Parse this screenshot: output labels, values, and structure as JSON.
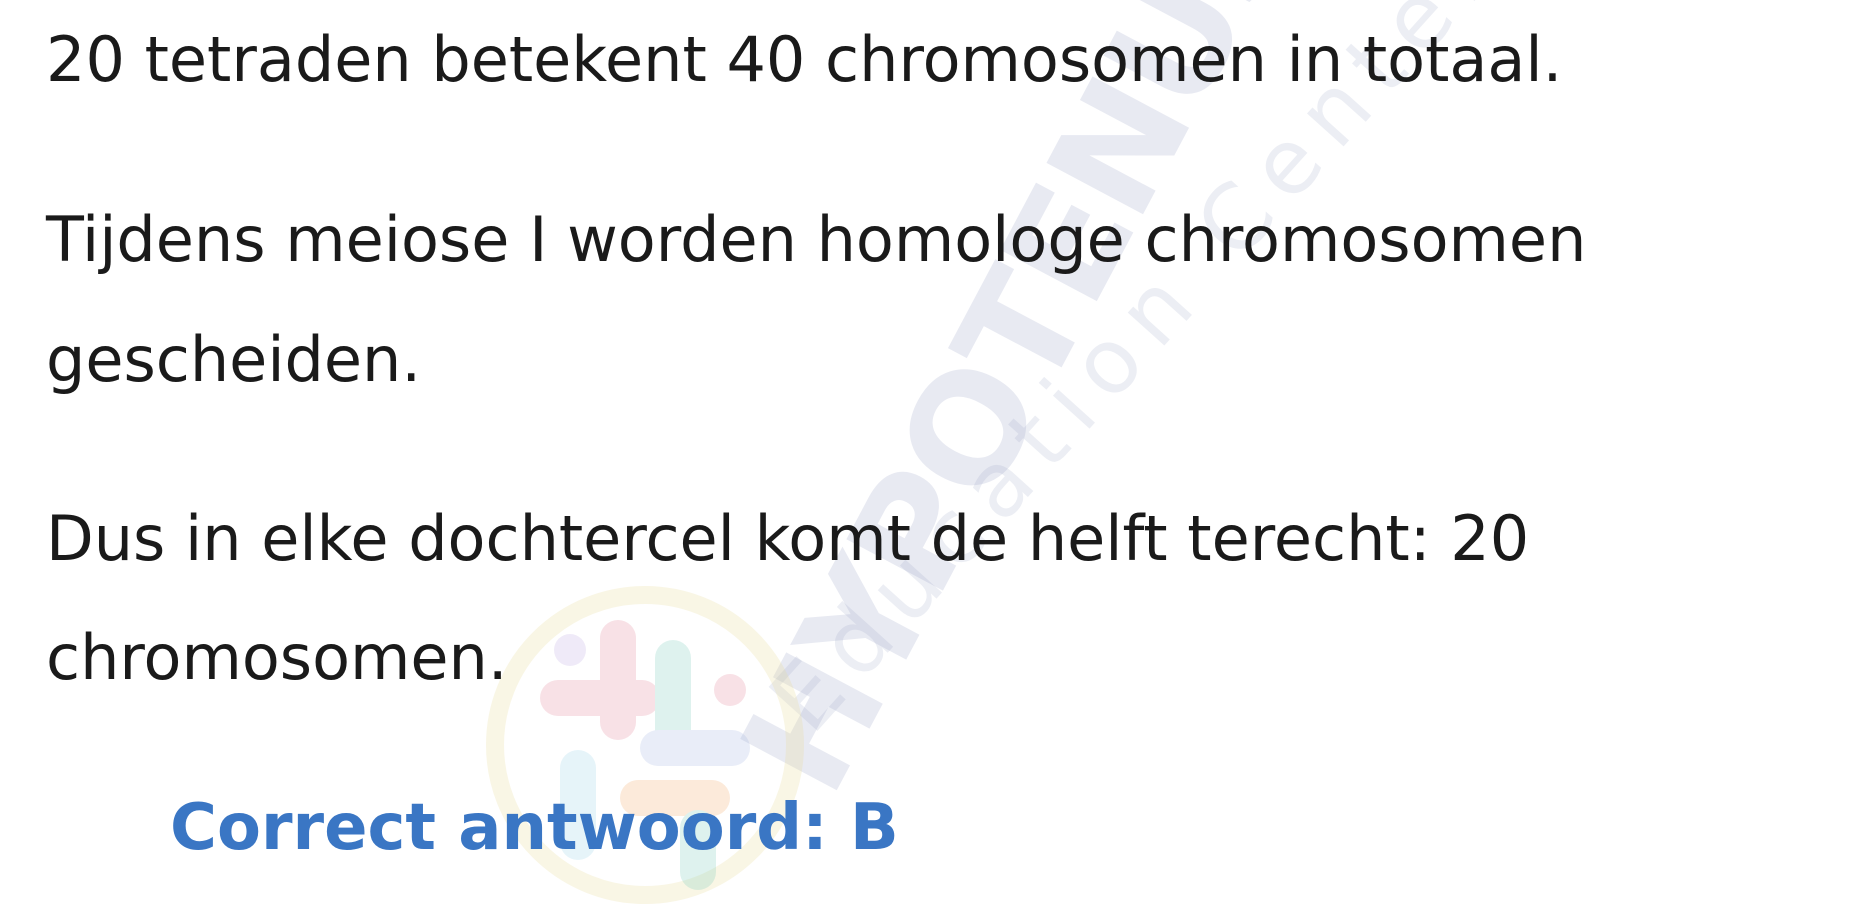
{
  "watermark": {
    "brand": "HYPOTENUSE",
    "tagline": "Education Center"
  },
  "content": {
    "paragraph_1": "20 tetraden betekent 40 chromosomen in totaal.",
    "paragraph_2_line_1": "Tijdens meiose I worden homologe chromosomen",
    "paragraph_2_line_2": "gescheiden.",
    "paragraph_3_line_1": "Dus in elke dochtercel komt de helft terecht: 20",
    "paragraph_3_line_2": "chromosomen."
  },
  "answer": {
    "text": "Correct antwoord: B",
    "color": "#3a76c4"
  },
  "colors": {
    "text": "#1a1a1a",
    "background": "#ffffff"
  }
}
